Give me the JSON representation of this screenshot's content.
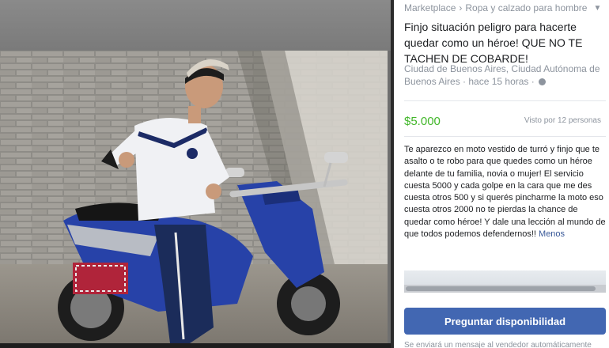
{
  "listing": {
    "breadcrumb": [
      "Marketplace",
      "Ropa y calzado para hombre"
    ],
    "chevron_icon": "chevron-down-icon",
    "title": "Finjo situación peligro para hacerte quedar como un héroe! QUE NO TE TACHEN DE COBARDE!",
    "location": "Ciudad de Buenos Aires, Ciudad Autónoma de Buenos Aires · hace 15 horas ·",
    "location_icon": "globe-icon",
    "price": "$5.000",
    "views": "Visto por 12 personas",
    "description": "Te aparezco en moto vestido de turró y finjo que te asalto o te robo para que quedes como un héroe delante de tu familia, novia o mujer! El servicio cuesta 5000 y cada golpe en la cara que me des cuesta otros 500 y si querés pincharme la moto eso cuesta otros 2000 no te pierdas la chance de quedar como héroe! Y dale una lección al mundo de que todos podemos defendernos!!",
    "more_link": "Menos",
    "ask_button": "Preguntar disponibilidad",
    "footnote": "Se enviará un mensaje al vendedor automáticamente"
  },
  "photo": {
    "subject": "listing-photo"
  },
  "colors": {
    "price": "#42b72a",
    "button": "#4267b2",
    "muted": "#8d949e",
    "link": "#385898"
  }
}
